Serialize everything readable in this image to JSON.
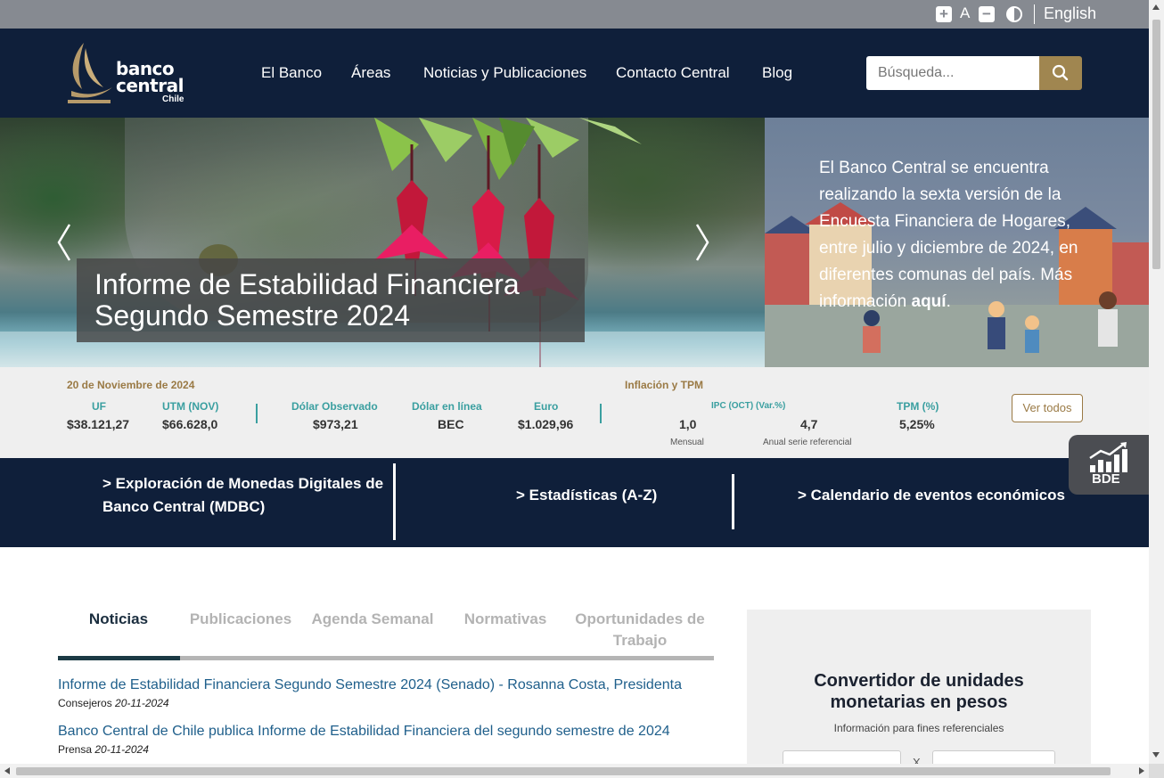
{
  "utility": {
    "increase_font": "+",
    "font_label": "A",
    "decrease_font": "−",
    "language": "English"
  },
  "header": {
    "logo_line1": "banco",
    "logo_line2": "central",
    "logo_sub": "Chile",
    "nav": [
      "El Banco",
      "Áreas",
      "Noticias y Publicaciones",
      "Contacto Central",
      "Blog"
    ],
    "search_placeholder": "Búsqueda..."
  },
  "hero": {
    "caption_line1": "Informe de Estabilidad Financiera",
    "caption_line2": "Segundo Semestre 2024"
  },
  "promo": {
    "text": "El Banco Central se encuentra realizando la sexta versión de la Encuesta Financiera de Hogares, entre julio y diciembre de 2024, en diferentes comunas del país. Más información ",
    "link": "aquí",
    "end": "."
  },
  "indicators": {
    "date": "20 de Noviembre de 2024",
    "uf_label": "UF",
    "uf_value": "$38.121,27",
    "utm_label": "UTM (NOV)",
    "utm_value": "$66.628,0",
    "dolar_obs_label": "Dólar Observado",
    "dolar_obs_value": "$973,21",
    "dolar_linea_label": "Dólar en línea",
    "dolar_linea_value": "BEC",
    "euro_label": "Euro",
    "euro_value": "$1.029,96",
    "inflacion_title": "Inflación y TPM",
    "ipc_label": "IPC (OCT) (Var.%)",
    "ipc_mensual_value": "1,0",
    "ipc_mensual_sub": "Mensual",
    "ipc_anual_value": "4,7",
    "ipc_anual_sub": "Anual serie referencial",
    "tpm_label": "TPM (%)",
    "tpm_value": "5,25%",
    "ver_todos": "Ver todos"
  },
  "quicklinks": {
    "mdbc_line1": "> Exploración de Monedas Digitales de",
    "mdbc_line2": "Banco Central (MDBC)",
    "estadisticas": "> Estadísticas (A-Z)",
    "calendario": "> Calendario de eventos económicos"
  },
  "bde": {
    "label": "BDE"
  },
  "tabs": {
    "noticias": "Noticias",
    "publicaciones": "Publicaciones",
    "agenda": "Agenda Semanal",
    "normativas": "Normativas",
    "oportunidades_line1": "Oportunidades de",
    "oportunidades_line2": "Trabajo"
  },
  "news": [
    {
      "title": "Informe de Estabilidad Financiera Segundo Semestre 2024 (Senado) - Rosanna Costa, Presidenta",
      "category": "Consejeros",
      "date": "20-11-2024"
    },
    {
      "title": "Banco Central de Chile publica Informe de Estabilidad Financiera del segundo semestre de 2024",
      "category": "Prensa",
      "date": "20-11-2024"
    }
  ],
  "converter": {
    "title_line1": "Convertidor de unidades",
    "title_line2": "monetarias en pesos",
    "note": "Información para fines referenciales",
    "times": "X"
  },
  "colors": {
    "navy": "#0f1f3a",
    "gold": "#a08650",
    "teal": "#3a9fa0",
    "link_blue": "#1f5f8b"
  }
}
